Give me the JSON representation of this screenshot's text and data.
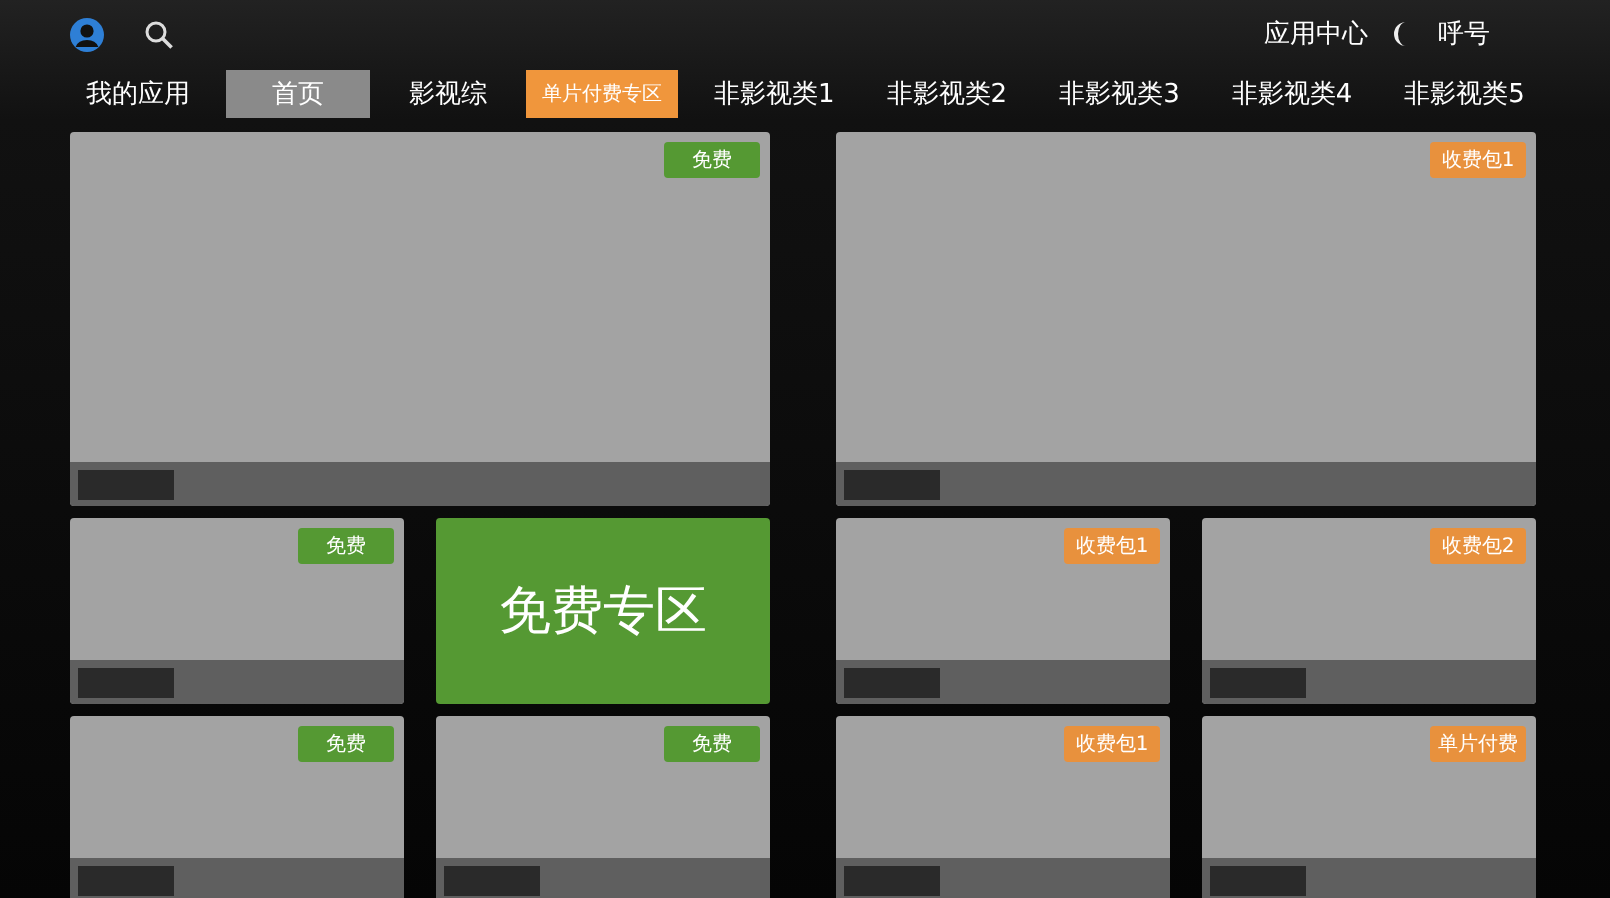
{
  "header": {
    "links": [
      "应用中心",
      "呼号"
    ]
  },
  "tabs": [
    {
      "label": "我的应用",
      "selected": false,
      "kind": "plain"
    },
    {
      "label": "首页",
      "selected": true,
      "kind": "plain"
    },
    {
      "label": "影视综",
      "selected": false,
      "kind": "plain"
    },
    {
      "label": "单片付费专区",
      "selected": false,
      "kind": "promo"
    },
    {
      "label": "非影视类1",
      "selected": false,
      "kind": "plain"
    },
    {
      "label": "非影视类2",
      "selected": false,
      "kind": "plain"
    },
    {
      "label": "非影视类3",
      "selected": false,
      "kind": "plain"
    },
    {
      "label": "非影视类4",
      "selected": false,
      "kind": "plain"
    },
    {
      "label": "非影视类5",
      "selected": false,
      "kind": "plain"
    }
  ],
  "left_panel": {
    "cards": [
      {
        "kind": "feature",
        "badge": {
          "text": "免费",
          "color": "#559933"
        }
      },
      {
        "kind": "tile",
        "badge": {
          "text": "免费",
          "color": "#559933"
        }
      },
      {
        "kind": "zone",
        "title": "免费专区"
      },
      {
        "kind": "tile",
        "badge": {
          "text": "免费",
          "color": "#559933"
        }
      },
      {
        "kind": "tile",
        "badge": {
          "text": "免费",
          "color": "#559933"
        }
      }
    ]
  },
  "right_panel": {
    "cards": [
      {
        "kind": "feature",
        "badge": {
          "text": "收费包1",
          "color": "#e8913d"
        }
      },
      {
        "kind": "tile",
        "badge": {
          "text": "收费包1",
          "color": "#e8913d"
        }
      },
      {
        "kind": "tile",
        "badge": {
          "text": "收费包2",
          "color": "#e8913d"
        }
      },
      {
        "kind": "tile",
        "badge": {
          "text": "收费包1",
          "color": "#e8913d"
        }
      },
      {
        "kind": "tile",
        "badge": {
          "text": "单片付费",
          "color": "#e8913d"
        }
      }
    ]
  }
}
